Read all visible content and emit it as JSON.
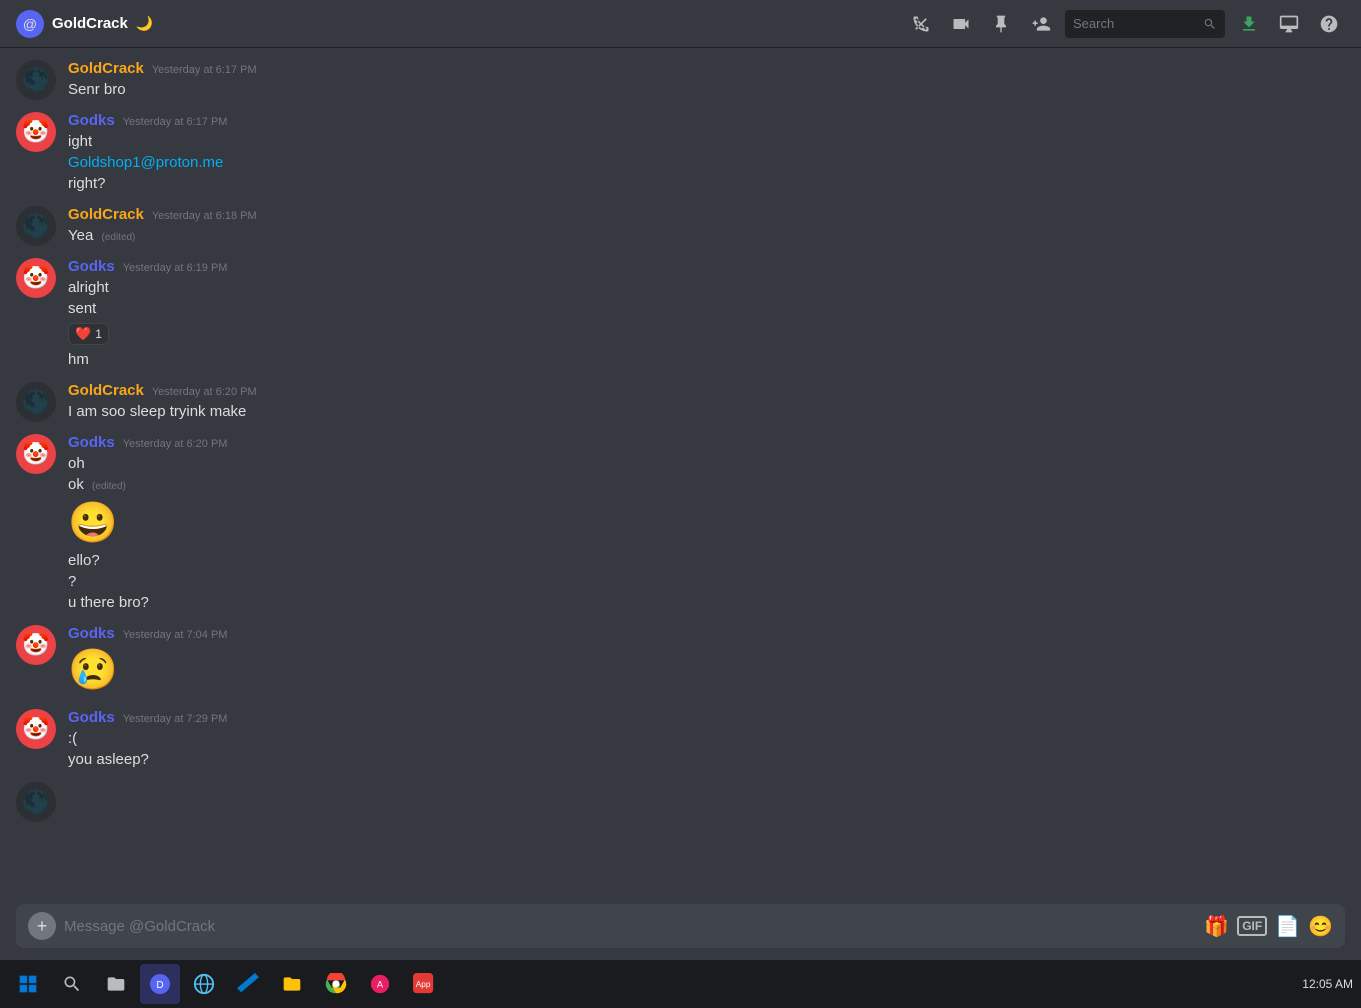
{
  "app": {
    "title": "GoldCrack",
    "moon_emoji": "🌙",
    "logo_icon": "@"
  },
  "toolbar": {
    "phone_icon": "📵",
    "video_icon": "📹",
    "pin_icon": "📌",
    "add_friend_icon": "👤+",
    "search_placeholder": "Search",
    "download_icon": "⬇",
    "monitor_icon": "🖥",
    "help_icon": "❓"
  },
  "messages": [
    {
      "id": "msg1",
      "user": "GoldCrack",
      "user_class": "goldcrack",
      "timestamp": "Yesterday at 6:17 PM",
      "avatar_emoji": "🌑",
      "lines": [
        "Senr bro"
      ],
      "edited": false
    },
    {
      "id": "msg2",
      "user": "Godks",
      "user_class": "godks",
      "timestamp": "Yesterday at 6:17 PM",
      "avatar_emoji": "🤡",
      "lines": [
        "ight",
        "Goldshop1@proton.me",
        "right?"
      ],
      "edited": false,
      "link_line": 1
    },
    {
      "id": "msg3",
      "user": "GoldCrack",
      "user_class": "goldcrack",
      "timestamp": "Yesterday at 6:18 PM",
      "avatar_emoji": "🌑",
      "lines": [
        "Yea"
      ],
      "edited": true
    },
    {
      "id": "msg4",
      "user": "Godks",
      "user_class": "godks",
      "timestamp": "Yesterday at 6:19 PM",
      "avatar_emoji": "🤡",
      "lines": [
        "alright",
        "sent"
      ],
      "edited": false,
      "reaction": {
        "emoji": "❤️",
        "count": "1"
      },
      "extra_lines": [
        "hm"
      ]
    },
    {
      "id": "msg5",
      "user": "GoldCrack",
      "user_class": "goldcrack",
      "timestamp": "Yesterday at 6:20 PM",
      "avatar_emoji": "🌑",
      "lines": [
        "I am soo sleep tryink make"
      ],
      "edited": false
    },
    {
      "id": "msg6",
      "user": "Godks",
      "user_class": "godks",
      "timestamp": "Yesterday at 6:20 PM",
      "avatar_emoji": "🤡",
      "lines": [
        "oh",
        "ok"
      ],
      "ok_edited": true,
      "emoji_big": "😀",
      "extra_lines_after": [
        "ello?",
        "?",
        "u there bro?"
      ],
      "edited": false
    },
    {
      "id": "msg7",
      "user": "Godks",
      "user_class": "godks",
      "timestamp": "Yesterday at 7:04 PM",
      "avatar_emoji": "🤡",
      "emoji_big": "😢",
      "lines": [],
      "edited": false
    },
    {
      "id": "msg8",
      "user": "Godks",
      "user_class": "godks",
      "timestamp": "Yesterday at 7:29 PM",
      "avatar_emoji": "🤡",
      "lines": [
        ":(",
        "you asleep?"
      ],
      "edited": false
    },
    {
      "id": "msg9",
      "user": "GoldCrack",
      "user_class": "goldcrack",
      "timestamp": "",
      "avatar_emoji": "🌑",
      "lines": [],
      "edited": false,
      "partial": true
    }
  ],
  "input": {
    "placeholder": "Message @GoldCrack",
    "add_label": "+",
    "gift_icon": "🎁",
    "gif_label": "GIF",
    "sticker_icon": "📄",
    "emoji_icon": "😊"
  },
  "taskbar": {
    "items": [
      "⊞",
      "🔍",
      "📁",
      "📋",
      "🔔",
      "🟣",
      "🔵",
      "🔴",
      "🟡",
      "🎯"
    ],
    "clock": "12:05 AM"
  }
}
